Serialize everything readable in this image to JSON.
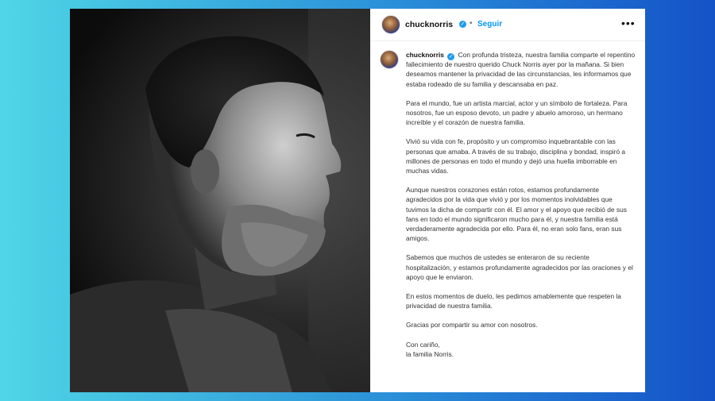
{
  "header": {
    "username": "chucknorris",
    "follow_label": "Seguir",
    "separator": "•",
    "more_label": "•••"
  },
  "caption": {
    "username": "chucknorris",
    "paragraphs": [
      "Con profunda tristeza, nuestra familia comparte el repentino fallecimiento de nuestro querido Chuck Norris ayer por la mañana. Si bien deseamos mantener la privacidad de las circunstancias, les informamos que estaba rodeado de su familia y descansaba en paz.",
      "Para el mundo, fue un artista marcial, actor y un símbolo de fortaleza. Para nosotros, fue un esposo devoto, un padre y abuelo amoroso, un hermano increíble y el corazón de nuestra familia.",
      "Vivió su vida con fe, propósito y un compromiso inquebrantable con las personas que amaba. A través de su trabajo, disciplina y bondad, inspiró a millones de personas en todo el mundo y dejó una huella imborrable en muchas vidas.",
      "Aunque nuestros corazones están rotos, estamos profundamente agradecidos por la vida que vivió y por los momentos inolvidables que tuvimos la dicha de compartir con él. El amor y el apoyo que recibió de sus fans en todo el mundo significaron mucho para él, y nuestra familia está verdaderamente agradecida por ello. Para él, no eran solo fans, eran sus amigos.",
      "Sabemos que muchos de ustedes se enteraron de su reciente hospitalización, y estamos profundamente agradecidos por las oraciones y el apoyo que le enviaron.",
      "En estos momentos de duelo, les pedimos amablemente que respeten la privacidad de nuestra familia.",
      "Gracias por compartir su amor con nosotros."
    ],
    "signoff_line1": "Con cariño,",
    "signoff_line2": "la familia Norris."
  },
  "colors": {
    "accent": "#0095f6",
    "verified": "#1d9bf0",
    "background_left": "#4fd6e6",
    "background_right": "#1452c8"
  },
  "icons": {
    "verified": "verified-badge-icon",
    "more": "more-options-icon"
  }
}
